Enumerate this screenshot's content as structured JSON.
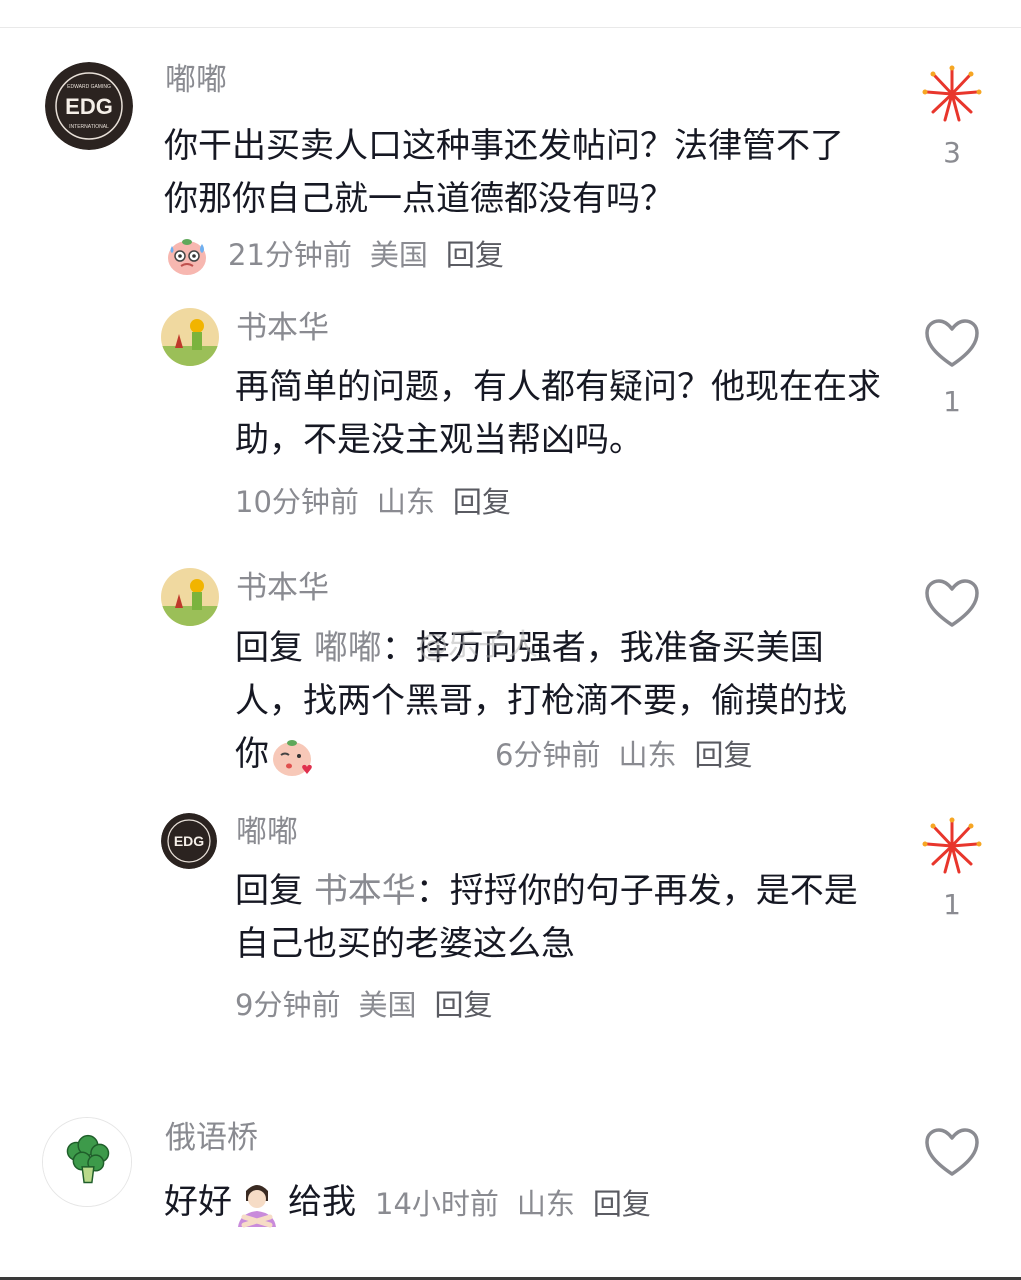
{
  "comments": [
    {
      "username": "嘟嘟",
      "text": "你干出买卖人口这种事还发帖问？法律管不了你那你自己就一点道德都没有吗？",
      "time": "21分钟前",
      "location": "美国",
      "reply_label": "回复",
      "likes": "3",
      "like_icon": "fireworks-icon",
      "replies": [
        {
          "username": "书本华",
          "text": "再简单的问题，有人都有疑问？他现在在求助，不是没主观当帮凶吗。",
          "time": "10分钟前",
          "location": "山东",
          "reply_label": "回复",
          "likes": "1",
          "like_icon": "heart-outline-icon"
        },
        {
          "username": "书本华",
          "reply_prefix": "回复",
          "reply_target": "嘟嘟",
          "text": "：择万向强者，我准备买美国人，找两个黑哥，打枪滴不要，偷摸的找你",
          "time": "6分钟前",
          "location": "山东",
          "reply_label": "回复",
          "likes": "",
          "like_icon": "heart-outline-icon"
        },
        {
          "username": "嘟嘟",
          "reply_prefix": "回复",
          "reply_target": "书本华",
          "text": "：捋捋你的句子再发，是不是自己也买的老婆这么急",
          "time": "9分钟前",
          "location": "美国",
          "reply_label": "回复",
          "likes": "1",
          "like_icon": "fireworks-icon"
        }
      ]
    },
    {
      "username": "俄语桥",
      "text": "好好",
      "text_after_emoji": "给我",
      "time": "14小时前",
      "location": "山东",
      "reply_label": "回复",
      "likes": "",
      "like_icon": "heart-outline-icon"
    }
  ],
  "watermark": "@乐子人",
  "colors": {
    "text": "#161823",
    "secondary": "#8a8b91",
    "firework": "#e8362c"
  }
}
